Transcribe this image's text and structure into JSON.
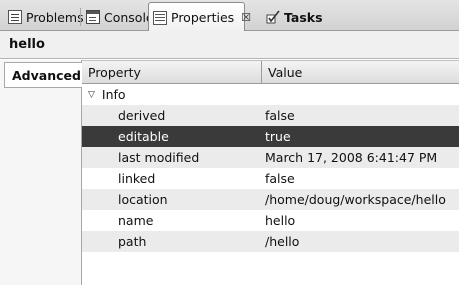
{
  "tabs": [
    {
      "label": "Problems",
      "icon": "problems-icon"
    },
    {
      "label": "Console",
      "icon": "console-icon"
    },
    {
      "label": "Properties",
      "icon": "properties-icon",
      "active": true,
      "close": "☒"
    },
    {
      "label": "Tasks",
      "icon": "tasks-icon"
    }
  ],
  "title": "hello",
  "left_tab": "Advanced",
  "table": {
    "headers": {
      "property": "Property",
      "value": "Value"
    },
    "group": {
      "label": "Info",
      "twisty": "▽"
    },
    "rows": [
      {
        "property": "derived",
        "value": "false"
      },
      {
        "property": "editable",
        "value": "true",
        "selected": true
      },
      {
        "property": "last modified",
        "value": "March 17, 2008 6:41:47 PM"
      },
      {
        "property": "linked",
        "value": "false"
      },
      {
        "property": "location",
        "value": "/home/doug/workspace/hello"
      },
      {
        "property": "name",
        "value": "hello"
      },
      {
        "property": "path",
        "value": "/hello"
      }
    ]
  },
  "colors": {
    "selection": "#3a3a3a",
    "shade": "#ebebeb"
  }
}
